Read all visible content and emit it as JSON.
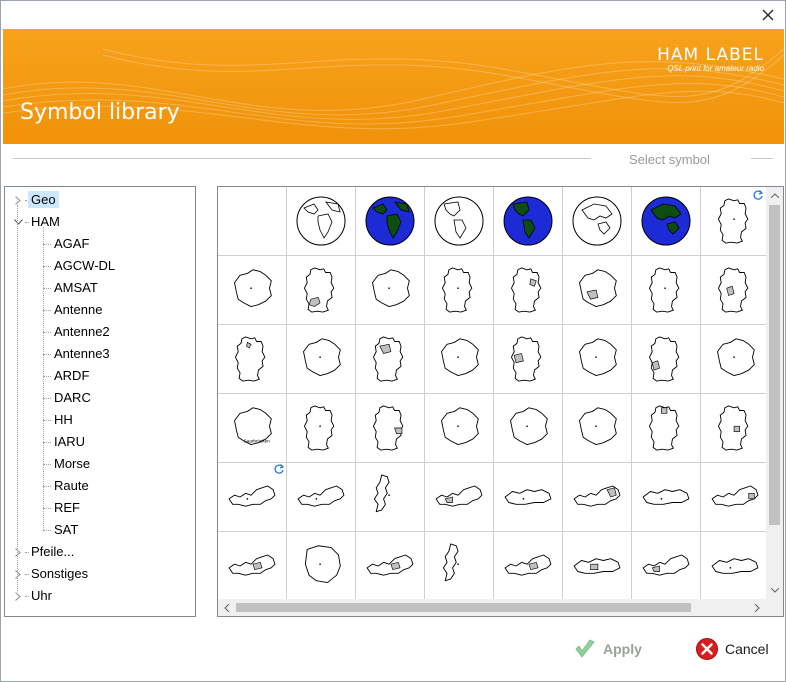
{
  "window": {
    "close_glyph": "✕"
  },
  "banner": {
    "brand_name": "HAM LABEL",
    "brand_sub": "QSL print for amateur radio",
    "title": "Symbol library"
  },
  "section": {
    "title": "Select symbol"
  },
  "tree": {
    "items": [
      {
        "label": "Geo",
        "level": 0,
        "state": "collapsed",
        "selected": true
      },
      {
        "label": "HAM",
        "level": 0,
        "state": "expanded",
        "selected": false
      },
      {
        "label": "AGAF",
        "level": 1
      },
      {
        "label": "AGCW-DL",
        "level": 1
      },
      {
        "label": "AMSAT",
        "level": 1
      },
      {
        "label": "Antenne",
        "level": 1
      },
      {
        "label": "Antenne2",
        "level": 1
      },
      {
        "label": "Antenne3",
        "level": 1
      },
      {
        "label": "ARDF",
        "level": 1
      },
      {
        "label": "DARC",
        "level": 1
      },
      {
        "label": "HH",
        "level": 1
      },
      {
        "label": "IARU",
        "level": 1
      },
      {
        "label": "Morse",
        "level": 1
      },
      {
        "label": "Raute",
        "level": 1
      },
      {
        "label": "REF",
        "level": 1
      },
      {
        "label": "SAT",
        "level": 1
      },
      {
        "label": "Pfeile...",
        "level": 0,
        "state": "collapsed",
        "selected": false
      },
      {
        "label": "Sonstiges",
        "level": 0,
        "state": "collapsed",
        "selected": false
      },
      {
        "label": "Uhr",
        "level": 0,
        "state": "collapsed",
        "selected": false
      }
    ]
  },
  "symbols": {
    "rows": [
      [
        "empty",
        "globe-outline-americas-africa",
        "globe-blue-africa",
        "globe-outline-americas",
        "globe-blue-americas",
        "globe-outline-europe",
        "globe-blue-europe",
        "map-germany"
      ],
      [
        "map-baden-wuerttemberg",
        "map-germany-bw",
        "map-bavaria",
        "map-germany-outline",
        "map-germany-berlin",
        "map-brandenburg",
        "map-germany-outline",
        "map-germany-hessen"
      ],
      [
        "map-germany-hamburg",
        "map-mecklenburg",
        "map-germany-nds",
        "map-niedersachsen",
        "map-germany-nrw",
        "map-nordrhein-westfalen",
        "map-germany-rlp",
        "map-rheinland-pfalz"
      ],
      [
        "map-saarland",
        "map-germany-outline",
        "map-germany-sachsen",
        "map-sachsen-anhalt",
        "map-sachsen",
        "map-schleswig-holstein",
        "map-germany-sh",
        "map-germany-thueringen"
      ],
      [
        "map-austria",
        "map-austria-outline",
        "map-vorarlberg",
        "map-austria-kaernten",
        "map-niederoesterreich",
        "map-austria-noe",
        "map-oberoesterreich",
        "map-austria-ooe"
      ],
      [
        "map-austria-burgenland",
        "map-salzburg-region",
        "map-austria-salzburg",
        "map-salzburg",
        "map-austria-steiermark",
        "map-steiermark",
        "map-austria-tirol",
        "map-tirol"
      ]
    ],
    "map_labels": {
      "saarland": "Saarbrücken"
    }
  },
  "footer": {
    "apply_label": "Apply",
    "cancel_label": "Cancel"
  },
  "colors": {
    "banner_orange": "#f39a12",
    "globe_ocean": "#1d2bd6",
    "globe_land": "#0e4d12",
    "region_fill": "#c0c0c0",
    "selection": "#cce8ff",
    "cancel_red": "#d81e1e",
    "apply_green": "#8fd19a"
  }
}
